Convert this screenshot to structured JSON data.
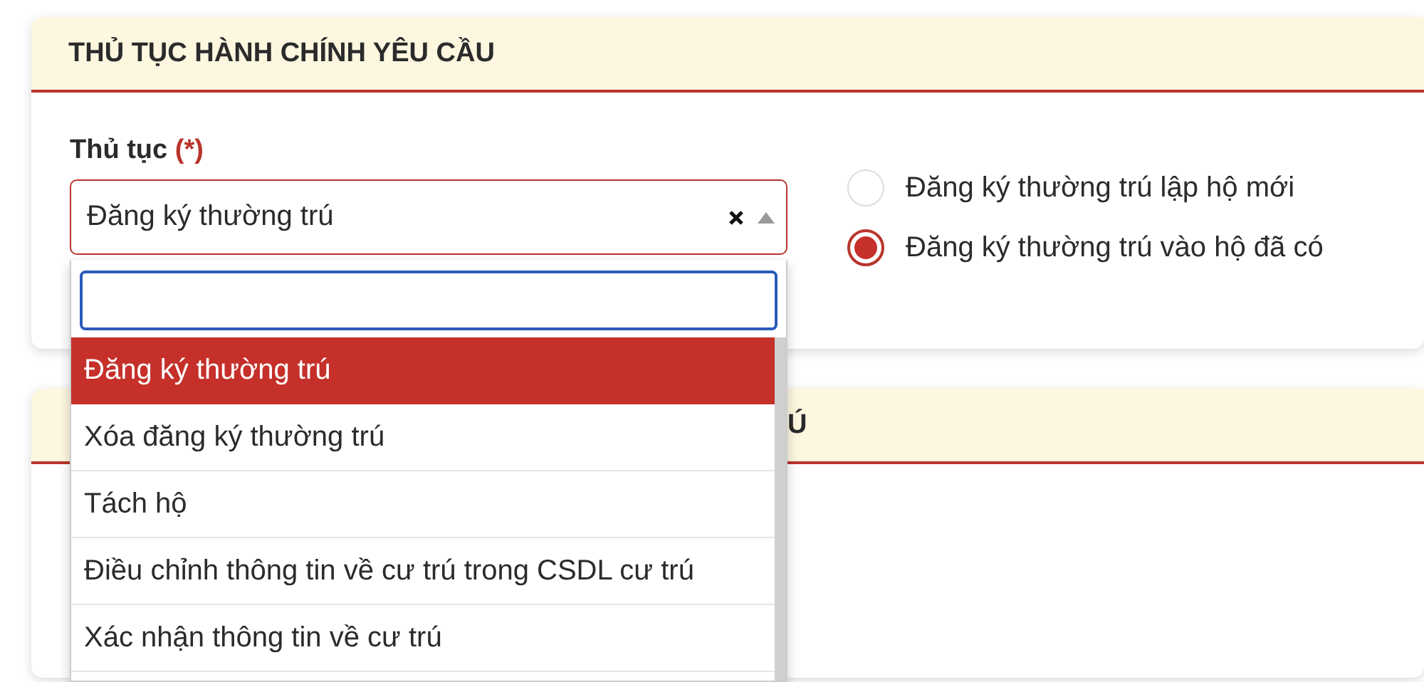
{
  "section_1": {
    "title": "THỦ TỤC HÀNH CHÍNH YÊU CẦU",
    "field": {
      "label": "Thủ tục",
      "required_mark": "(*)",
      "value": "Đăng ký thường trú"
    },
    "radios": [
      {
        "label": "Đăng ký thường trú lập hộ mới",
        "selected": false
      },
      {
        "label": "Đăng ký thường trú vào hộ đã có",
        "selected": true
      }
    ]
  },
  "section_2": {
    "title": "Ú"
  },
  "dropdown": {
    "options": [
      {
        "label": "Đăng ký thường trú",
        "selected": true
      },
      {
        "label": "Xóa đăng ký thường trú",
        "selected": false
      },
      {
        "label": "Tách hộ",
        "selected": false
      },
      {
        "label": "Điều chỉnh thông tin về cư trú trong CSDL cư trú",
        "selected": false
      },
      {
        "label": "Xác nhận thông tin về cư trú",
        "selected": false
      }
    ]
  }
}
